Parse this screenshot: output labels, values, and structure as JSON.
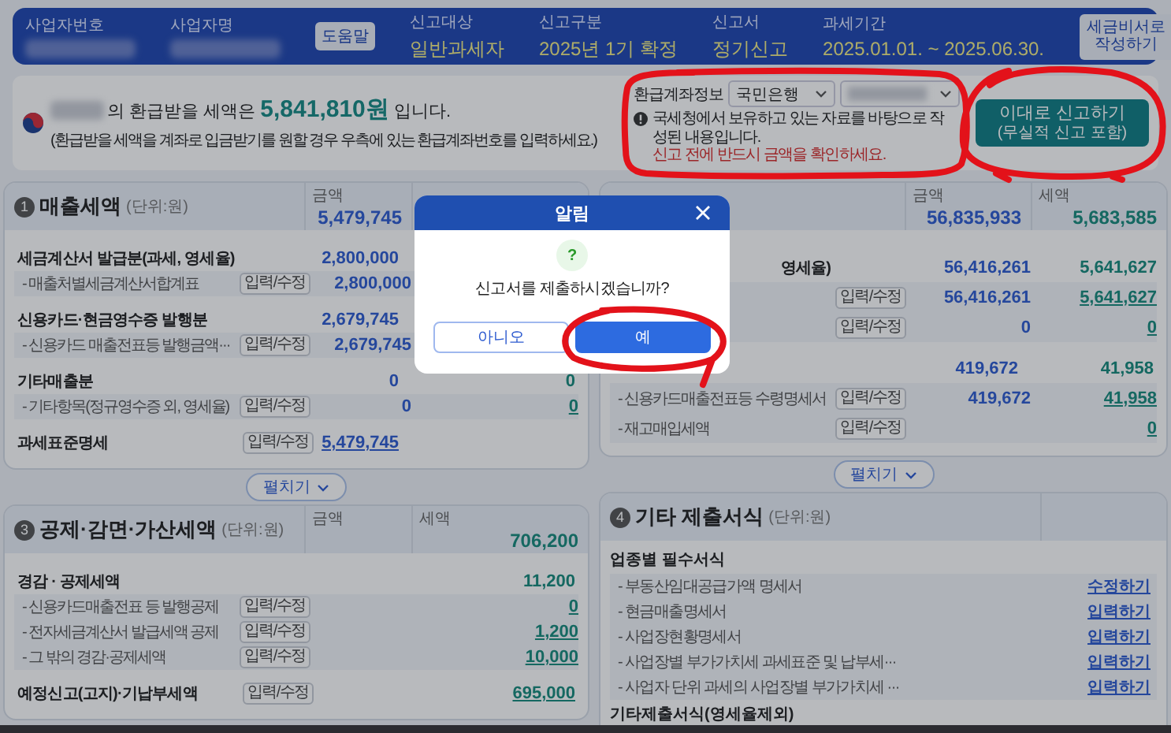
{
  "header": {
    "fields": [
      {
        "kind": "blurred",
        "label": "사업자번호"
      },
      {
        "kind": "blurred",
        "label": "사업자명"
      },
      {
        "kind": "button",
        "label": "도움말"
      },
      {
        "kind": "value",
        "label": "신고대상",
        "value": "일반과세자"
      },
      {
        "kind": "value",
        "label": "신고구분",
        "value": "2025년 1기 확정"
      },
      {
        "kind": "value",
        "label": "신고서",
        "value": "정기신고"
      },
      {
        "kind": "value",
        "label": "과세기간",
        "value": "2025.01.01. ~ 2025.06.30."
      }
    ],
    "action_lines": [
      "세금비서로",
      "작성하기"
    ]
  },
  "refund": {
    "message": "의 환급받을 세액은 **5,841,810원** 입니다.",
    "note": "(환급받을 세액을 계좌로 입금받기를 원할 경우 우측에 있는 환급계좌번호를 입력하세요.)",
    "account_label": "환급계좌정보",
    "bank": "국민은행",
    "notice": "국세청에서 보유하고 있는 자료를 바탕으로 작성된 내용입니다.",
    "warning": "신고 전에 반드시 금액을 확인하세요.",
    "submit_lines": [
      "이대로 신고하기",
      "(무실적 신고 포함)"
    ]
  },
  "columns": [
    [
      {
        "kind": "amounts",
        "number": "1",
        "title": "매출세액",
        "unit": "(단위:원)",
        "columns": [
          {
            "label": "금액",
            "total": "5,479,745"
          }
        ],
        "expand_label": "펼치기",
        "rows": [
          {
            "kind": "main",
            "label": "세금계산서 발급분(과세, 영세율)",
            "amount": {
              "text": "2,800,000",
              "link": false
            }
          },
          {
            "kind": "sub",
            "label": "- 매출처별세금계산서합계표",
            "button": "입력/수정",
            "amount": {
              "text": "2,800,000",
              "link": false
            }
          },
          {
            "kind": "main",
            "label": "신용카드·현금영수증 발행분",
            "amount": {
              "text": "2,679,745",
              "link": false
            }
          },
          {
            "kind": "sub",
            "label": "- 신용카드 매출전표등 발행금액···",
            "button": "입력/수정",
            "amount": {
              "text": "2,679,745",
              "link": false
            }
          },
          {
            "kind": "main",
            "label": "기타매출분",
            "amount": {
              "text": "0",
              "link": false
            },
            "tax": {
              "text": "0",
              "link": false
            }
          },
          {
            "kind": "sub",
            "label": "- 기타항목(정규영수증 외, 영세율)",
            "button": "입력/수정",
            "amount": {
              "text": "0",
              "link": false
            },
            "tax": {
              "text": "0",
              "link": true
            }
          },
          {
            "kind": "main",
            "label": "과세표준명세",
            "button": "입력/수정",
            "amount": {
              "text": "5,479,745",
              "link": true
            }
          }
        ]
      },
      {
        "kind": "amounts",
        "number": "3",
        "title": "공제·감면·가산세액",
        "unit": "(단위:원)",
        "columns": [
          {
            "label": "금액"
          },
          {
            "label": "세액",
            "total": "706,200"
          }
        ],
        "rows": [
          {
            "kind": "main",
            "label": "경감 · 공제세액",
            "tax": {
              "text": "11,200",
              "link": false
            }
          },
          {
            "kind": "sub",
            "label": "- 신용카드매출전표 등 발행공제",
            "button": "입력/수정",
            "tax": {
              "text": "0",
              "link": true
            }
          },
          {
            "kind": "sub",
            "label": "- 전자세금계산서 발급세액 공제",
            "button": "입력/수정",
            "tax": {
              "text": "1,200",
              "link": true
            }
          },
          {
            "kind": "sub",
            "label": "- 그 밖의 경감·공제세액",
            "button": "입력/수정",
            "tax": {
              "text": "10,000",
              "link": true
            }
          },
          {
            "kind": "main",
            "label": "예정신고(고지)·기납부세액",
            "button": "입력/수정",
            "tax": {
              "text": "695,000",
              "link": true
            }
          }
        ]
      }
    ],
    [
      {
        "kind": "amounts",
        "columns": [
          {
            "label": "금액",
            "total": "56,835,933"
          },
          {
            "label": "세액",
            "total": "5,683,585"
          }
        ],
        "expand_label": "펼치기",
        "rows": [
          {
            "kind": "partial",
            "label": "영세율)",
            "amount": {
              "text": "56,416,261",
              "link": false
            },
            "tax": {
              "text": "5,641,627",
              "link": false
            }
          },
          {
            "kind": "sub",
            "button": "입력/수정",
            "amount": {
              "text": "56,416,261",
              "link": false
            },
            "tax": {
              "text": "5,641,627",
              "link": true
            }
          },
          {
            "kind": "sub",
            "button": "입력/수정",
            "amount": {
              "text": "0",
              "link": false
            },
            "tax": {
              "text": "0",
              "link": true
            }
          },
          {
            "kind": "main",
            "amount": {
              "text": "419,672",
              "link": false
            },
            "tax": {
              "text": "41,958",
              "link": false
            }
          },
          {
            "kind": "sub",
            "label": "- 신용카드매출전표등 수령명세서",
            "button": "입력/수정",
            "amount": {
              "text": "419,672",
              "link": false
            },
            "tax": {
              "text": "41,958",
              "link": true
            }
          },
          {
            "kind": "sub",
            "label": "- 재고매입세액",
            "button": "입력/수정",
            "tax": {
              "text": "0",
              "link": true
            }
          }
        ]
      },
      {
        "kind": "forms",
        "number": "4",
        "title": "기타 제출서식",
        "unit": "(단위:원)",
        "groups": [
          {
            "title": "업종별 필수서식",
            "items": [
              {
                "label": "- 부동산임대공급가액 명세서",
                "action": "수정하기"
              },
              {
                "label": "- 현금매출명세서",
                "action": "입력하기"
              },
              {
                "label": "- 사업장현황명세서",
                "action": "입력하기"
              },
              {
                "label": "- 사업장별 부가가치세 과세표준 및 납부세···",
                "action": "입력하기"
              },
              {
                "label": "- 사업자 단위 과세의 사업장별 부가가치세 ···",
                "action": "입력하기"
              }
            ]
          },
          {
            "title": "기타제출서식(영세율제외)"
          }
        ]
      }
    ]
  ],
  "dialog": {
    "title": "알림",
    "icon": "?",
    "message": "신고서를 제출하시겠습니까?",
    "buttons": [
      {
        "label": "아니오",
        "primary": false
      },
      {
        "label": "예",
        "primary": true
      }
    ]
  }
}
